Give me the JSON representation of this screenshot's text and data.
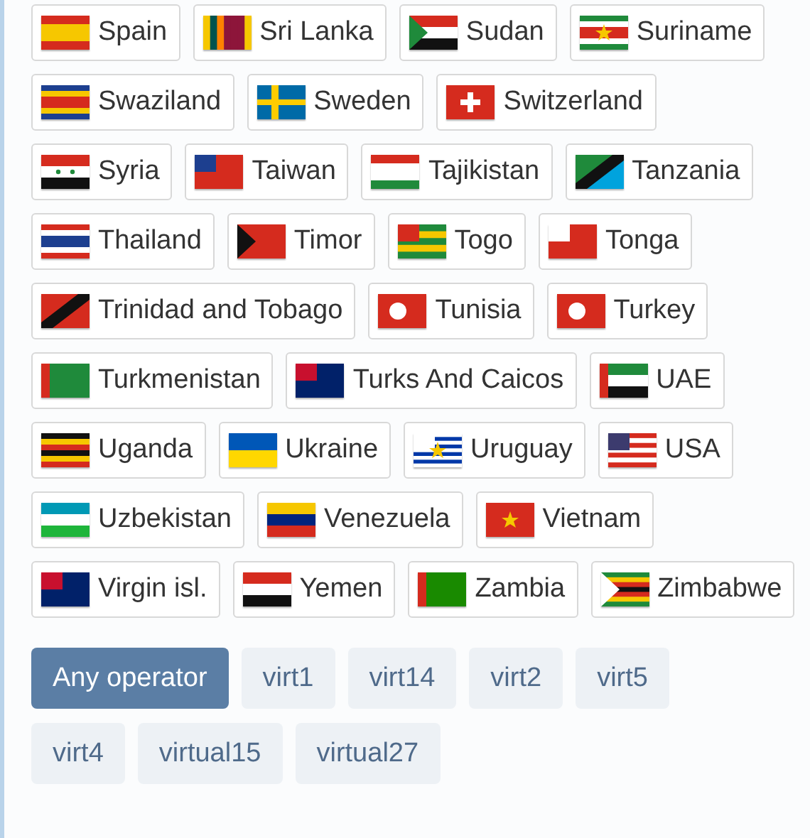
{
  "countries": [
    "Spain",
    "Sri Lanka",
    "Sudan",
    "Suriname",
    "Swaziland",
    "Sweden",
    "Switzerland",
    "Syria",
    "Taiwan",
    "Tajikistan",
    "Tanzania",
    "Thailand",
    "Timor",
    "Togo",
    "Tonga",
    "Trinidad and Tobago",
    "Tunisia",
    "Turkey",
    "Turkmenistan",
    "Turks And Caicos",
    "UAE",
    "Uganda",
    "Ukraine",
    "Uruguay",
    "USA",
    "Uzbekistan",
    "Venezuela",
    "Vietnam",
    "Virgin isl.",
    "Yemen",
    "Zambia",
    "Zimbabwe"
  ],
  "operators": [
    {
      "label": "Any operator",
      "selected": true
    },
    {
      "label": "virt1",
      "selected": false
    },
    {
      "label": "virt14",
      "selected": false
    },
    {
      "label": "virt2",
      "selected": false
    },
    {
      "label": "virt5",
      "selected": false
    },
    {
      "label": "virt4",
      "selected": false
    },
    {
      "label": "virtual15",
      "selected": false
    },
    {
      "label": "virtual27",
      "selected": false
    }
  ]
}
